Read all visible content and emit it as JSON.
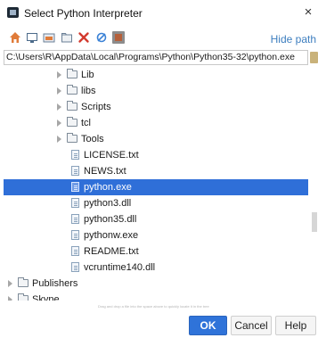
{
  "window": {
    "title": "Select Python Interpreter",
    "close": "×"
  },
  "toolbar": {
    "hide_path": "Hide path",
    "buttons": [
      "home-icon",
      "desktop-icon",
      "project-icon",
      "new-folder-icon",
      "delete-icon",
      "refresh-icon",
      "show-hidden-icon"
    ]
  },
  "path": {
    "value": "C:\\Users\\R\\AppData\\Local\\Programs\\Python\\Python35-32\\python.exe"
  },
  "tree": [
    {
      "type": "folder",
      "label": "Lib",
      "expandable": true
    },
    {
      "type": "folder",
      "label": "libs",
      "expandable": true
    },
    {
      "type": "folder",
      "label": "Scripts",
      "expandable": true
    },
    {
      "type": "folder",
      "label": "tcl",
      "expandable": true
    },
    {
      "type": "folder",
      "label": "Tools",
      "expandable": true
    },
    {
      "type": "file",
      "label": "LICENSE.txt"
    },
    {
      "type": "file",
      "label": "NEWS.txt"
    },
    {
      "type": "file",
      "label": "python.exe",
      "selected": true
    },
    {
      "type": "file",
      "label": "python3.dll"
    },
    {
      "type": "file",
      "label": "python35.dll"
    },
    {
      "type": "file",
      "label": "pythonw.exe"
    },
    {
      "type": "file",
      "label": "README.txt"
    },
    {
      "type": "file",
      "label": "vcruntime140.dll"
    },
    {
      "type": "folder",
      "label": "Publishers",
      "expandable": true
    },
    {
      "type": "folder",
      "label": "Skype",
      "expandable": true
    }
  ],
  "hint": "Drag and drop a file into the space above to quickly locate it in the tree",
  "buttons": {
    "ok": "OK",
    "cancel": "Cancel",
    "help": "Help"
  },
  "colors": {
    "selection": "#2f6fd8",
    "accent_link": "#3d7ebf",
    "ok_button": "#2f73d9"
  }
}
